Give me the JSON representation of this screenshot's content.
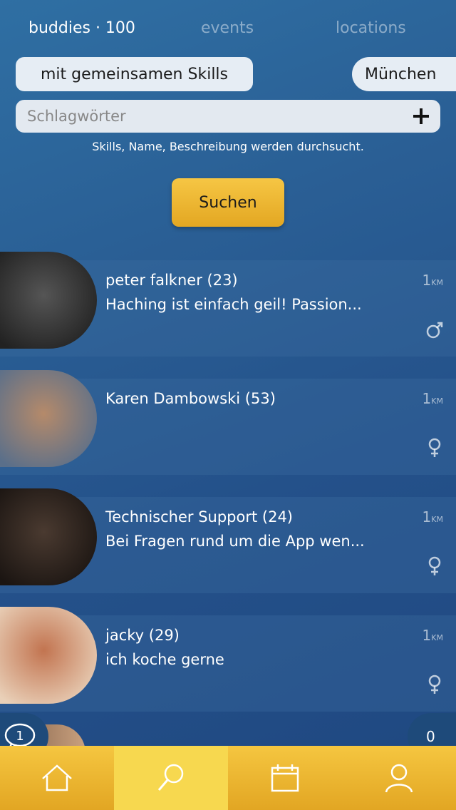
{
  "tabs": [
    {
      "label": "buddies · 100"
    },
    {
      "label": "events"
    },
    {
      "label": "locations"
    }
  ],
  "filters": {
    "skills_label": "mit gemeinsamen Skills",
    "city_label": "München"
  },
  "search": {
    "placeholder": "Schlagwörter",
    "hint": "Skills, Name, Beschreibung werden durchsucht.",
    "button_label": "Suchen"
  },
  "people": [
    {
      "name": "peter falkner (23)",
      "desc": "Haching ist einfach geil! Passion...",
      "dist": "1",
      "unit": "KM",
      "gender": "male",
      "avatar_colors": [
        "#555",
        "#222"
      ]
    },
    {
      "name": "Karen Dambowski (53)",
      "desc": "",
      "dist": "1",
      "unit": "KM",
      "gender": "female",
      "avatar_colors": [
        "#b58a6a",
        "#5a6f8a"
      ]
    },
    {
      "name": "Technischer Support (24)",
      "desc": "Bei Fragen rund um die App wen...",
      "dist": "1",
      "unit": "KM",
      "gender": "female",
      "avatar_colors": [
        "#4a3a30",
        "#1b1512"
      ]
    },
    {
      "name": "jacky (29)",
      "desc": "ich koche gerne",
      "dist": "1",
      "unit": "KM",
      "gender": "female",
      "avatar_colors": [
        "#c27450",
        "#e9d0b8"
      ]
    }
  ],
  "chat_badge": "1",
  "notifications_count": "0",
  "nav": [
    "home-icon",
    "search-icon",
    "calendar-icon",
    "profile-icon"
  ],
  "colors": {
    "accent": "#f2bd3c",
    "background": "#2a5f95"
  }
}
